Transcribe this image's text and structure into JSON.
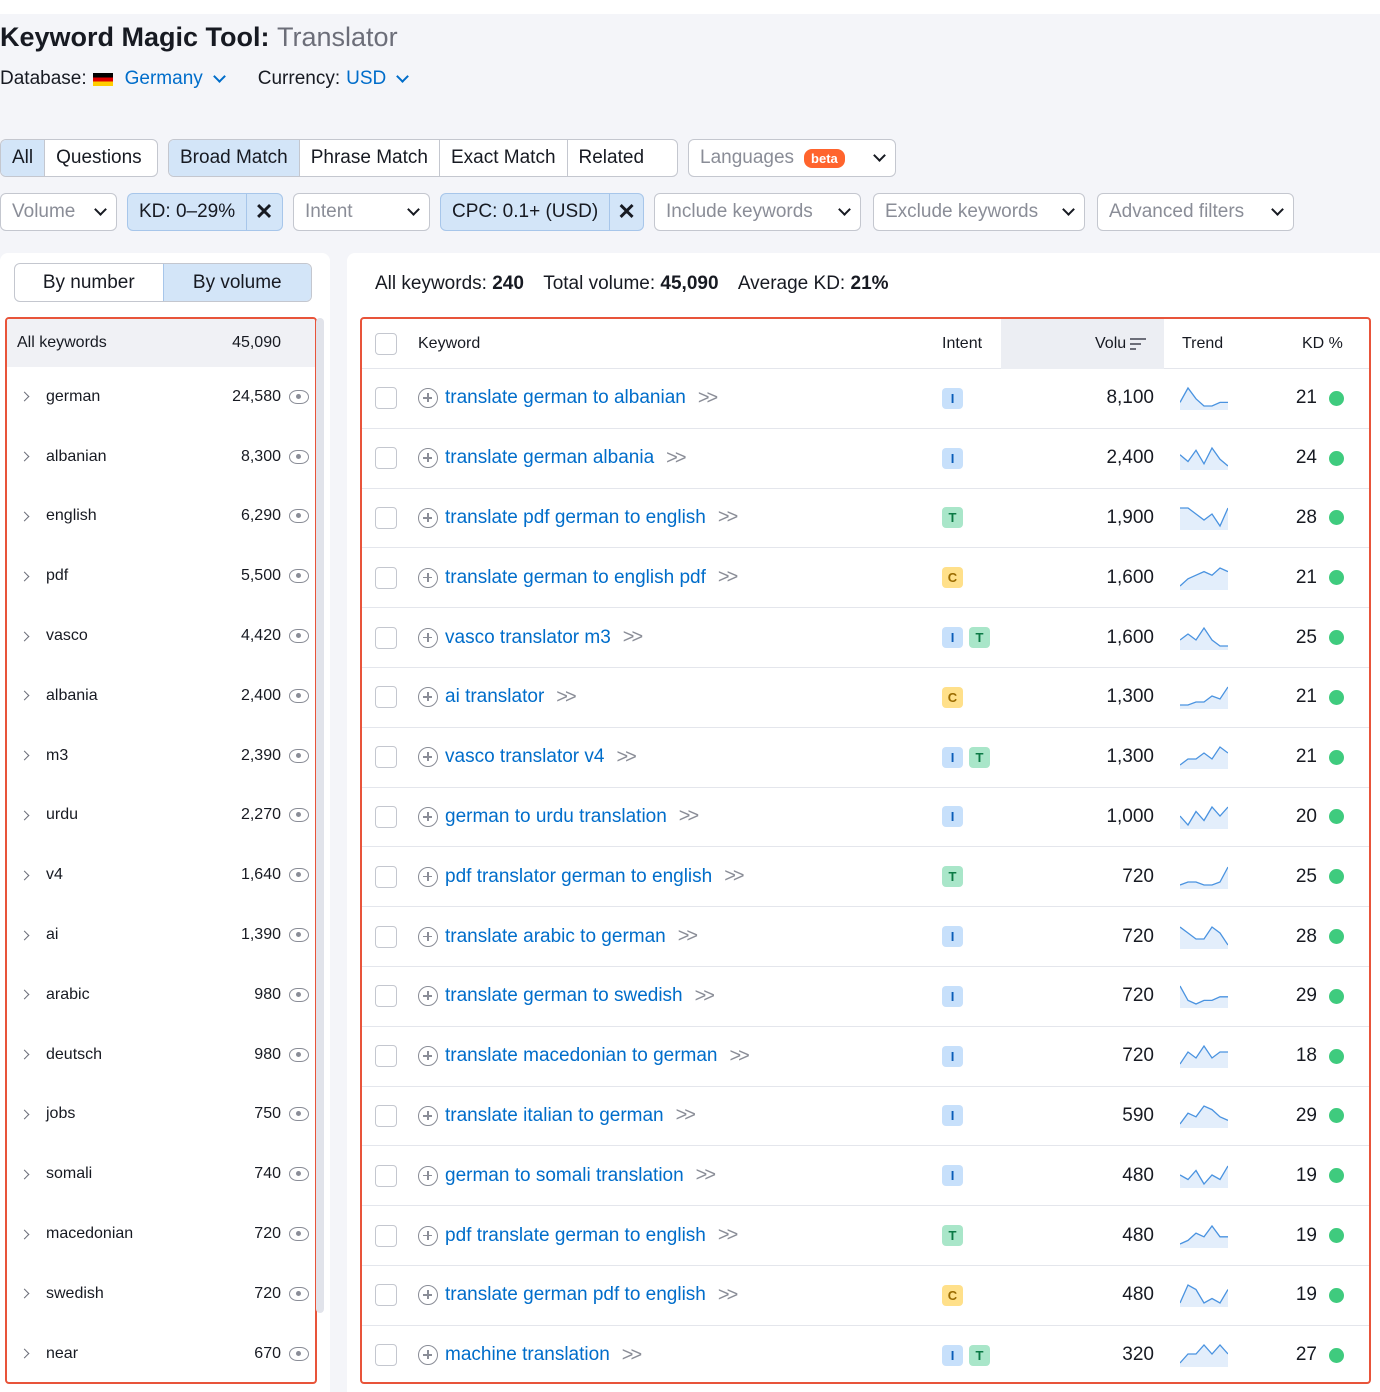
{
  "header": {
    "title": "Keyword Magic Tool:",
    "subtitle": "Translator",
    "database_label": "Database:",
    "database_value": "Germany",
    "currency_label": "Currency:",
    "currency_value": "USD"
  },
  "match_tabs": {
    "group1": [
      {
        "label": "All",
        "active": true
      },
      {
        "label": "Questions",
        "active": false
      }
    ],
    "group2": [
      {
        "label": "Broad Match",
        "active": true
      },
      {
        "label": "Phrase Match",
        "active": false
      },
      {
        "label": "Exact Match",
        "active": false
      },
      {
        "label": "Related",
        "active": false
      }
    ],
    "languages": "Languages",
    "beta": "beta"
  },
  "filters": {
    "volume": "Volume",
    "kd": "KD: 0–29%",
    "intent": "Intent",
    "cpc": "CPC: 0.1+ (USD)",
    "include": "Include keywords",
    "exclude": "Exclude keywords",
    "advanced": "Advanced filters",
    "close_glyph": "✕"
  },
  "left_panel": {
    "by_number": "By number",
    "by_volume": "By volume",
    "all_label": "All keywords",
    "all_value": "45,090",
    "groups": [
      {
        "name": "german",
        "value": "24,580"
      },
      {
        "name": "albanian",
        "value": "8,300"
      },
      {
        "name": "english",
        "value": "6,290"
      },
      {
        "name": "pdf",
        "value": "5,500"
      },
      {
        "name": "vasco",
        "value": "4,420"
      },
      {
        "name": "albania",
        "value": "2,400"
      },
      {
        "name": "m3",
        "value": "2,390"
      },
      {
        "name": "urdu",
        "value": "2,270"
      },
      {
        "name": "v4",
        "value": "1,640"
      },
      {
        "name": "ai",
        "value": "1,390"
      },
      {
        "name": "arabic",
        "value": "980"
      },
      {
        "name": "deutsch",
        "value": "980"
      },
      {
        "name": "jobs",
        "value": "750"
      },
      {
        "name": "somali",
        "value": "740"
      },
      {
        "name": "macedonian",
        "value": "720"
      },
      {
        "name": "swedish",
        "value": "720"
      },
      {
        "name": "near",
        "value": "670"
      }
    ]
  },
  "summary": {
    "all_label": "All keywords:",
    "all_value": "240",
    "total_label": "Total volume:",
    "total_value": "45,090",
    "kd_label": "Average KD:",
    "kd_value": "21%"
  },
  "table": {
    "headers": {
      "keyword": "Keyword",
      "intent": "Intent",
      "volume": "Volu",
      "trend": "Trend",
      "kd": "KD %"
    },
    "rows": [
      {
        "keyword": "translate german to albanian",
        "intents": [
          "I"
        ],
        "volume": "8,100",
        "kd": "21",
        "trend": [
          5,
          9,
          6,
          4,
          4,
          5,
          5
        ]
      },
      {
        "keyword": "translate german albania",
        "intents": [
          "I"
        ],
        "volume": "2,400",
        "kd": "24",
        "trend": [
          6,
          3,
          8,
          2,
          9,
          4,
          1
        ]
      },
      {
        "keyword": "translate pdf german to english",
        "intents": [
          "T"
        ],
        "volume": "1,900",
        "kd": "28",
        "trend": [
          7,
          7,
          6,
          5,
          6,
          4,
          7
        ]
      },
      {
        "keyword": "translate german to english pdf",
        "intents": [
          "C"
        ],
        "volume": "1,600",
        "kd": "21",
        "trend": [
          2,
          4,
          5,
          6,
          5,
          7,
          6
        ]
      },
      {
        "keyword": "vasco translator m3",
        "intents": [
          "I",
          "T"
        ],
        "volume": "1,600",
        "kd": "25",
        "trend": [
          5,
          6,
          5,
          7,
          5,
          4,
          4
        ]
      },
      {
        "keyword": "ai translator",
        "intents": [
          "C"
        ],
        "volume": "1,300",
        "kd": "21",
        "trend": [
          2,
          2,
          3,
          3,
          5,
          4,
          8
        ]
      },
      {
        "keyword": "vasco translator v4",
        "intents": [
          "I",
          "T"
        ],
        "volume": "1,300",
        "kd": "21",
        "trend": [
          4,
          5,
          5,
          6,
          5,
          7,
          6
        ]
      },
      {
        "keyword": "german to urdu translation",
        "intents": [
          "I"
        ],
        "volume": "1,000",
        "kd": "20",
        "trend": [
          6,
          4,
          7,
          5,
          8,
          6,
          8
        ]
      },
      {
        "keyword": "pdf translator german to english",
        "intents": [
          "T"
        ],
        "volume": "720",
        "kd": "25",
        "trend": [
          3,
          4,
          4,
          3,
          3,
          4,
          9
        ]
      },
      {
        "keyword": "translate arabic to german",
        "intents": [
          "I"
        ],
        "volume": "720",
        "kd": "28",
        "trend": [
          7,
          6,
          5,
          5,
          7,
          6,
          4
        ]
      },
      {
        "keyword": "translate german to swedish",
        "intents": [
          "I"
        ],
        "volume": "720",
        "kd": "29",
        "trend": [
          8,
          4,
          3,
          4,
          4,
          5,
          5
        ]
      },
      {
        "keyword": "translate macedonian to german",
        "intents": [
          "I"
        ],
        "volume": "720",
        "kd": "18",
        "trend": [
          5,
          7,
          6,
          8,
          6,
          7,
          7
        ]
      },
      {
        "keyword": "translate italian to german",
        "intents": [
          "I"
        ],
        "volume": "590",
        "kd": "29",
        "trend": [
          3,
          6,
          5,
          8,
          7,
          5,
          4
        ]
      },
      {
        "keyword": "german to somali translation",
        "intents": [
          "I"
        ],
        "volume": "480",
        "kd": "19",
        "trend": [
          6,
          5,
          7,
          4,
          6,
          5,
          8
        ]
      },
      {
        "keyword": "pdf translate german to english",
        "intents": [
          "T"
        ],
        "volume": "480",
        "kd": "19",
        "trend": [
          3,
          4,
          6,
          5,
          8,
          5,
          5
        ]
      },
      {
        "keyword": "translate german pdf to english",
        "intents": [
          "C"
        ],
        "volume": "480",
        "kd": "19",
        "trend": [
          3,
          7,
          6,
          3,
          4,
          3,
          6
        ]
      },
      {
        "keyword": "machine translation",
        "intents": [
          "I",
          "T"
        ],
        "volume": "320",
        "kd": "27",
        "trend": [
          4,
          5,
          5,
          6,
          5,
          6,
          5
        ]
      }
    ]
  },
  "colors": {
    "accent": "#006dca",
    "highlight_border": "#e8543a",
    "kd_dot": "#3fcb7e",
    "beta": "#ff642d"
  }
}
